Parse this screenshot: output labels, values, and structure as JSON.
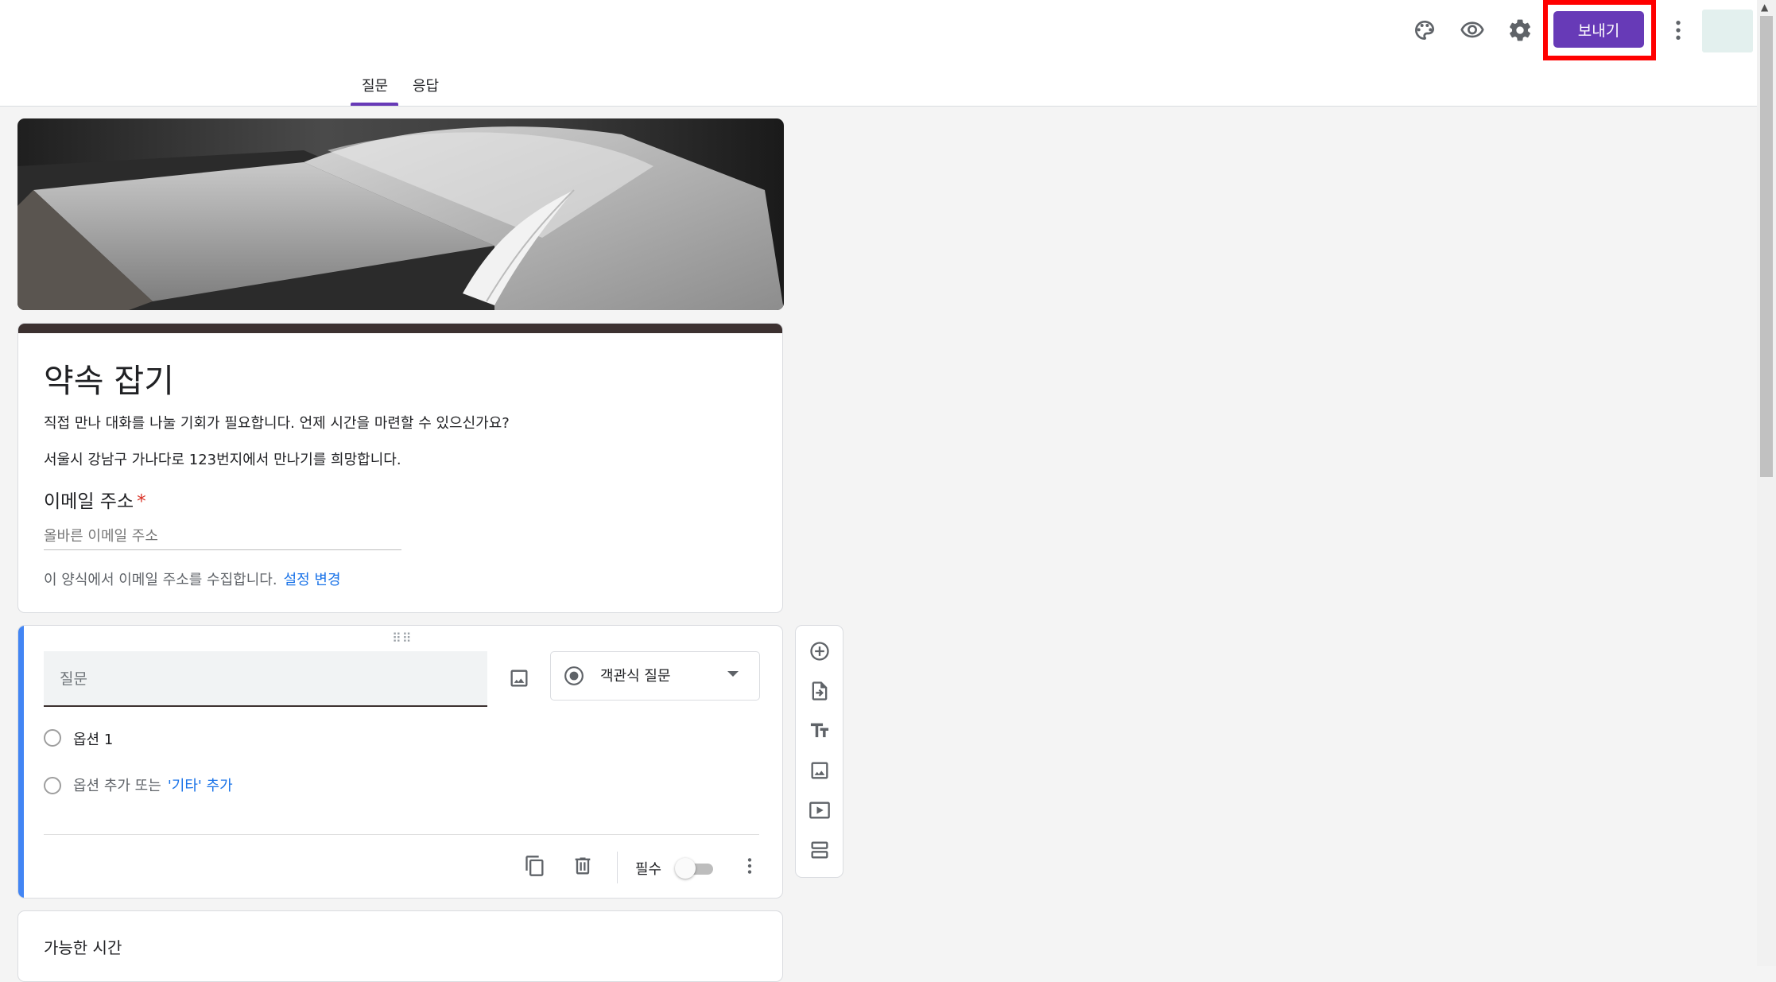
{
  "header": {
    "send_label": "보내기",
    "icons": [
      "palette-icon",
      "eye-icon",
      "gear-icon",
      "more-vert-icon"
    ]
  },
  "tabs": [
    {
      "label": "질문",
      "active": true
    },
    {
      "label": "응답",
      "active": false
    }
  ],
  "form": {
    "title": "약속 잡기",
    "description_lines": [
      "직접 만나 대화를 나눌 기회가 필요합니다. 언제 시간을 마련할 수 있으신가요?",
      "서울시 강남구 가나다로 123번지에서 만나기를 희망합니다."
    ],
    "email": {
      "label": "이메일 주소",
      "required_mark": "*",
      "placeholder": "올바른 이메일 주소",
      "note": "이 양식에서 이메일 주소를 수집합니다.",
      "settings_link": "설정 변경"
    }
  },
  "question": {
    "placeholder": "질문",
    "type_label": "객관식 질문",
    "options": [
      "옵션 1"
    ],
    "add_option": "옵션 추가 또는",
    "add_other": "'기타' 추가",
    "required_label": "필수",
    "required_on": false
  },
  "next_question": {
    "title": "가능한 시간"
  },
  "colors": {
    "accent": "#673ab7",
    "highlight": "#ff0000",
    "question_accent": "#4285f4",
    "link": "#1a73e8"
  }
}
